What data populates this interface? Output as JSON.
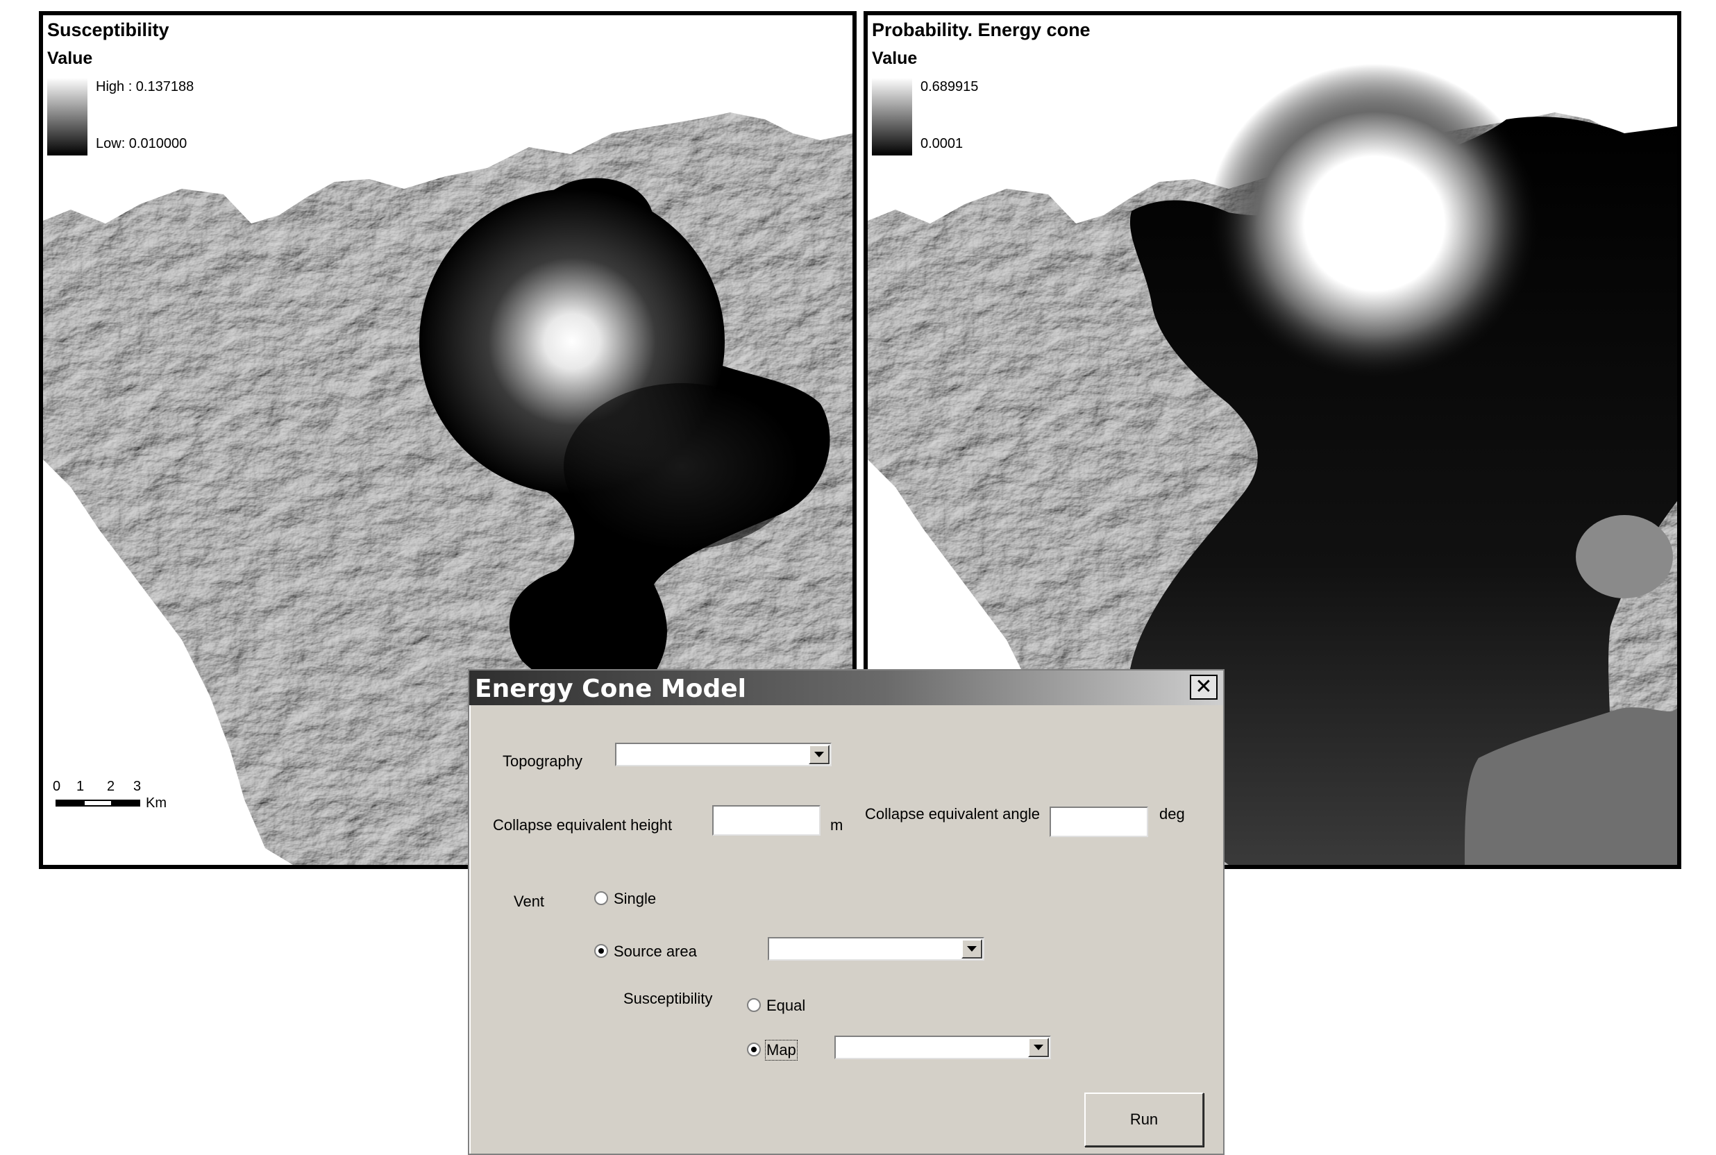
{
  "left_map": {
    "title": "Susceptibility",
    "legend_heading": "Value",
    "legend_high": "High : 0.137188",
    "legend_low": "Low: 0.010000",
    "scale_ticks": [
      "0",
      "1",
      "2",
      "3"
    ],
    "scale_unit": "Km"
  },
  "right_map": {
    "title": "Probability. Energy cone",
    "legend_heading": "Value",
    "legend_high": "0.689915",
    "legend_low": "0.0001"
  },
  "dialog": {
    "title": "Energy Cone Model",
    "close_glyph": "✕",
    "topography_label": "Topography",
    "topography_value": "",
    "height_label": "Collapse equivalent height",
    "height_value": "",
    "height_unit": "m",
    "angle_label": "Collapse equivalent angle",
    "angle_value": "",
    "angle_unit": "deg",
    "vent_label": "Vent",
    "vent_options": {
      "single": "Single",
      "source_area": "Source area"
    },
    "vent_selected": "Source area",
    "source_area_value": "",
    "susceptibility_label": "Susceptibility",
    "susceptibility_options": {
      "equal": "Equal",
      "map": "Map"
    },
    "susceptibility_selected": "Map",
    "map_value": "",
    "run_label": "Run"
  }
}
